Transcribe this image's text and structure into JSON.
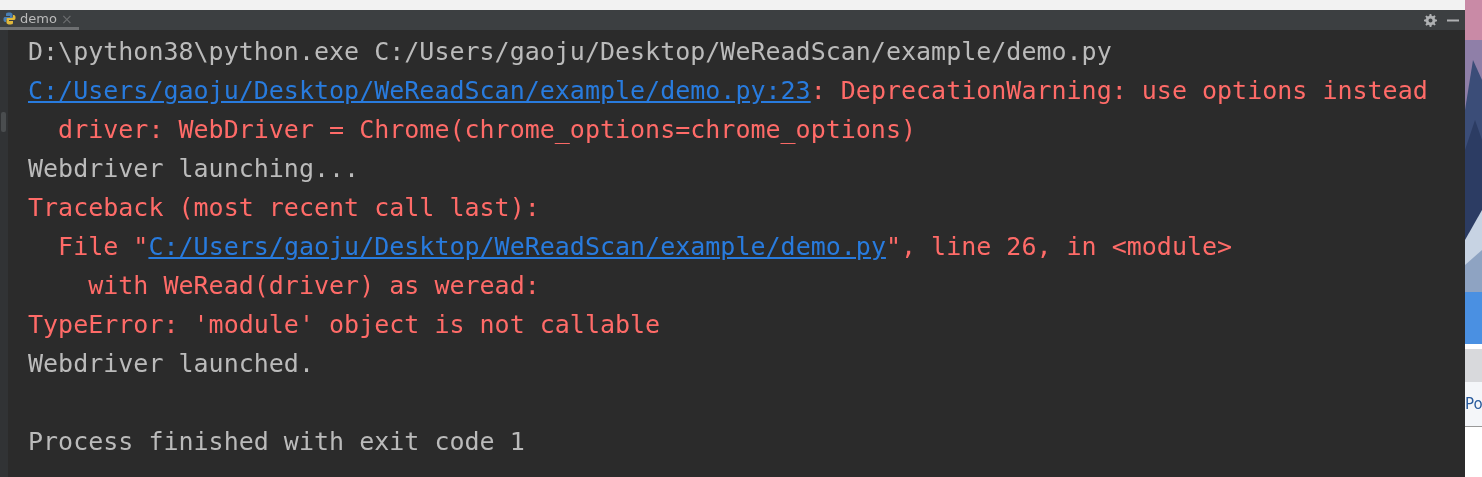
{
  "tab": {
    "label": "demo",
    "close": "×",
    "selected": true
  },
  "console": {
    "lines": [
      {
        "segments": [
          {
            "kind": "plain",
            "text": "D:\\python38\\python.exe C:/Users/gaoju/Desktop/WeReadScan/example/demo.py"
          }
        ]
      },
      {
        "segments": [
          {
            "kind": "link",
            "text": "C:/Users/gaoju/Desktop/WeReadScan/example/demo.py:23"
          },
          {
            "kind": "error",
            "text": ": DeprecationWarning: use options instead"
          }
        ]
      },
      {
        "segments": [
          {
            "kind": "error",
            "text": "  driver: WebDriver = Chrome(chrome_options=chrome_options)"
          }
        ]
      },
      {
        "segments": [
          {
            "kind": "plain",
            "text": "Webdriver launching..."
          }
        ]
      },
      {
        "segments": [
          {
            "kind": "error",
            "text": "Traceback (most recent call last):"
          }
        ]
      },
      {
        "segments": [
          {
            "kind": "error",
            "text": "  File \""
          },
          {
            "kind": "link",
            "text": "C:/Users/gaoju/Desktop/WeReadScan/example/demo.py"
          },
          {
            "kind": "error",
            "text": "\", line 26, in <module>"
          }
        ]
      },
      {
        "segments": [
          {
            "kind": "error",
            "text": "    with WeRead(driver) as weread:"
          }
        ]
      },
      {
        "segments": [
          {
            "kind": "error",
            "text": "TypeError: 'module' object is not callable"
          }
        ]
      },
      {
        "segments": [
          {
            "kind": "plain",
            "text": "Webdriver launched."
          }
        ]
      },
      {
        "kind": "blank"
      },
      {
        "segments": [
          {
            "kind": "plain",
            "text": "Process finished with exit code 1"
          }
        ]
      }
    ]
  },
  "background_window": {
    "text": "Po"
  }
}
